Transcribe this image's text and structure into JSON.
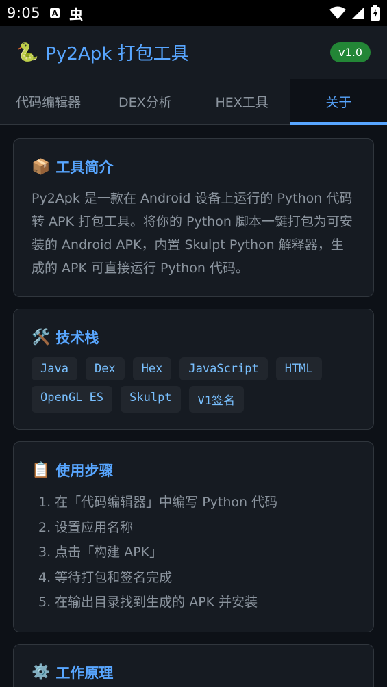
{
  "status_bar": {
    "time": "9:05",
    "notif_a": "A",
    "notif_bug": "虫"
  },
  "header": {
    "logo_icon": "🐍",
    "title": "Py2Apk 打包工具",
    "version": "v1.0"
  },
  "tabs": [
    {
      "label": "代码编辑器"
    },
    {
      "label": "DEX分析"
    },
    {
      "label": "HEX工具"
    },
    {
      "label": "关于",
      "active": true
    }
  ],
  "cards": {
    "intro": {
      "icon": "📦",
      "title": "工具简介",
      "text": "Py2Apk 是一款在 Android 设备上运行的 Python 代码转 APK 打包工具。将你的 Python 脚本一键打包为可安装的 Android APK，内置 Skulpt Python 解释器，生成的 APK 可直接运行 Python 代码。"
    },
    "tech": {
      "icon": "🛠️",
      "title": "技术栈",
      "tags": [
        "Java",
        "Dex",
        "Hex",
        "JavaScript",
        "HTML",
        "OpenGL ES",
        "Skulpt",
        "V1签名"
      ]
    },
    "steps": {
      "icon": "📋",
      "title": "使用步骤",
      "items": [
        "1. 在「代码编辑器」中编写 Python 代码",
        "2. 设置应用名称",
        "3. 点击「构建 APK」",
        "4. 等待打包和签名完成",
        "5. 在输出目录找到生成的 APK 并安装"
      ]
    },
    "principle": {
      "icon": "⚙️",
      "title": "工作原理"
    }
  },
  "colors": {
    "background": "#0d1117",
    "surface": "#161b22",
    "accent": "#58a6ff",
    "badge": "#238636"
  }
}
